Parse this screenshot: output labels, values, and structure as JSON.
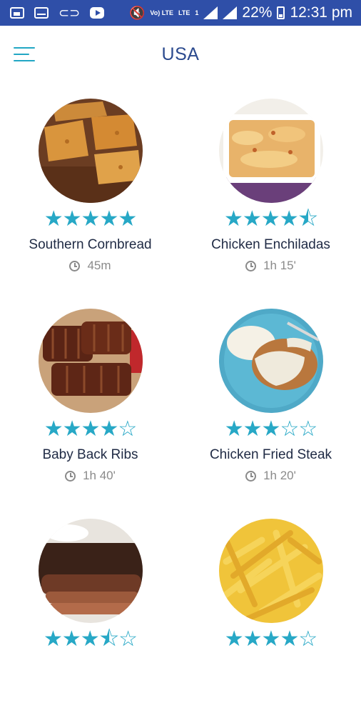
{
  "status_bar": {
    "battery": "22%",
    "time": "12:31 pm",
    "network": "LTE",
    "volte": "Vo) LTE",
    "sim": "1"
  },
  "app_bar": {
    "title": "USA",
    "menu_icon": "hamburger-menu-icon"
  },
  "colors": {
    "accent": "#27a8c6",
    "status_bar": "#2f4fa8",
    "title": "#2b4a8e"
  },
  "recipes": [
    {
      "name": "Southern Cornbread",
      "time": "45m",
      "rating": 5,
      "max_rating": 5
    },
    {
      "name": "Chicken Enchiladas",
      "time": "1h 15'",
      "rating": 4.5,
      "max_rating": 5
    },
    {
      "name": "Baby Back Ribs",
      "time": "1h 40'",
      "rating": 4,
      "max_rating": 5
    },
    {
      "name": "Chicken Fried Steak",
      "time": "1h 20'",
      "rating": 3,
      "max_rating": 5
    },
    {
      "name": "",
      "time": "",
      "rating": 3.5,
      "max_rating": 5
    },
    {
      "name": "",
      "time": "",
      "rating": 4,
      "max_rating": 5
    }
  ]
}
